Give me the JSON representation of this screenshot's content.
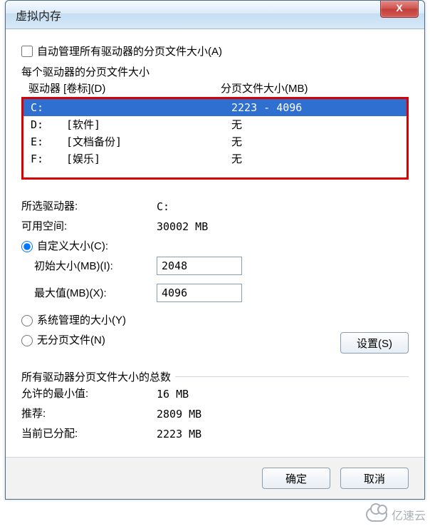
{
  "window": {
    "title": "虚拟内存",
    "close_symbol": "X"
  },
  "auto_manage": {
    "label": "自动管理所有驱动器的分页文件大小(A)",
    "checked": false
  },
  "drive_section": {
    "header": "每个驱动器的分页文件大小",
    "col_drive": "驱动器 [卷标](D)",
    "col_size": "分页文件大小(MB)"
  },
  "drives": [
    {
      "letter": "C:",
      "label": "",
      "size": "2223 - 4096",
      "selected": true
    },
    {
      "letter": "D:",
      "label": "[软件]",
      "size": "无",
      "selected": false
    },
    {
      "letter": "E:",
      "label": "[文档备份]",
      "size": "无",
      "selected": false
    },
    {
      "letter": "F:",
      "label": "[娱乐]",
      "size": "无",
      "selected": false
    }
  ],
  "selected_drive": {
    "label": "所选驱动器:",
    "value": "C:",
    "free_label": "可用空间:",
    "free_value": "30002 MB"
  },
  "size_options": {
    "custom": {
      "label": "自定义大小(C):",
      "checked": true,
      "initial_label": "初始大小(MB)(I):",
      "initial_value": "2048",
      "max_label": "最大值(MB)(X):",
      "max_value": "4096"
    },
    "system": {
      "label": "系统管理的大小(Y)",
      "checked": false
    },
    "none": {
      "label": "无分页文件(N)",
      "checked": false
    }
  },
  "set_button": "设置(S)",
  "totals": {
    "header": "所有驱动器分页文件大小的总数",
    "min_label": "允许的最小值:",
    "min_value": "16 MB",
    "rec_label": "推荐:",
    "rec_value": "2809 MB",
    "cur_label": "当前已分配:",
    "cur_value": "2223 MB"
  },
  "buttons": {
    "ok": "确定",
    "cancel": "取消"
  },
  "watermark": "亿速云"
}
